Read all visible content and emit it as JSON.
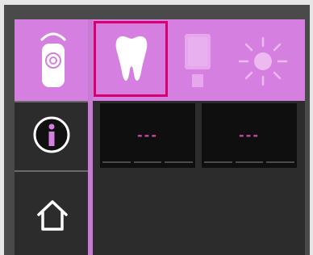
{
  "tiles": [
    {
      "value": "---"
    },
    {
      "value": "---"
    }
  ],
  "icons": {
    "curing_light": "curing-light-icon",
    "info": "info-icon",
    "home": "home-icon",
    "tooth": "tooth-icon",
    "material": "material-cartridge-icon",
    "light": "light-sun-icon"
  },
  "colors": {
    "accent": "#d57fe0",
    "selection": "#d6006f",
    "value": "#c84aa6"
  }
}
